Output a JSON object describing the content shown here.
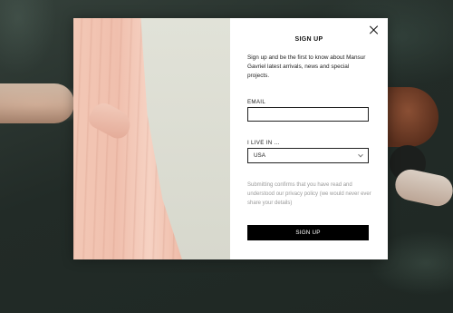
{
  "modal": {
    "title": "SIGN UP",
    "intro": "Sign up and be the first to know about Mansur Gavriel latest arrivals, news and special projects.",
    "email_label": "EMAIL",
    "email_value": "",
    "country_label": "I LIVE IN ...",
    "country_selected": "USA",
    "disclaimer": "Submitting confirms that you have read and understood our privacy policy (we would never ever share your details)",
    "submit_label": "SIGN UP",
    "close_icon": "close-icon"
  }
}
